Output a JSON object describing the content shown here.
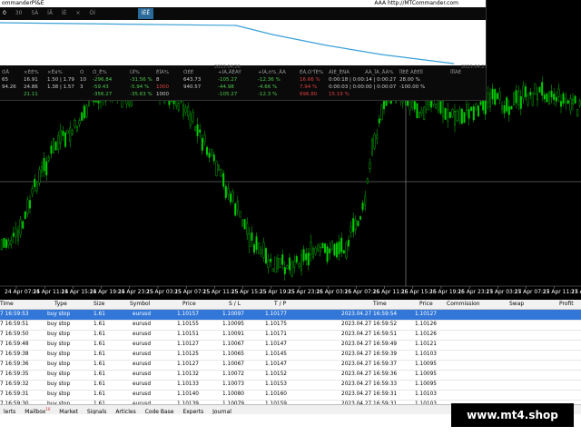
{
  "panel": {
    "title_left": "ommanderPl&E",
    "title_right": "ÀÂÀ http://MTCommander.com",
    "toolbar": [
      "0",
      "30",
      "5À",
      "ÍÃ",
      "ÌÈ",
      "×",
      "ÓÍ"
    ],
    "toolbar_badge": "ÍÈÊ",
    "equity_dates": [
      "2023.04.26",
      "2023.04.27"
    ],
    "stats_header": [
      "ÓÅ",
      "×ÈÉ%",
      "×Ëä%",
      "Ó",
      "Ó_Ë%",
      "ÙÎ%",
      "ÈÎÁ%",
      "ÓÉÉ",
      "+ÍÁ,ÄÊÀÝ",
      "+ÍÁ,ñ%¸ÄÀ",
      "ÉÁ,Ó\"ÏÈ%",
      "ÃÍÉ_ËÑÀ",
      "ÁÀ_ÏÀ¸ÄÀ%",
      "ÎÍÈÊ ÀÈÉÎÍ",
      "ÎÍÏÀÈ"
    ],
    "stats_rows": [
      [
        "65",
        "16.91",
        "1.50 | 1.79",
        "10",
        "-296.84",
        "-31.56 %",
        "8",
        "643.73",
        "-105.27",
        "-12.36 %",
        "16.66 %",
        "0:00:18 | 0:00:14 | 0:00:27",
        "28.00 %"
      ],
      [
        "94.26",
        "24.86",
        "1.38 | 1.57",
        "3",
        "-59.43",
        "-5.94 %",
        "1000",
        "940.57",
        "-44.98",
        "-4.66 %",
        "7.94 %",
        "0:00:03 | 0:00:00 | 0:00:07",
        "-100.00 %"
      ],
      [
        "",
        "21.11",
        "",
        "",
        "-356.27",
        "-35.63 %",
        "1000",
        "",
        "-105.27",
        "-12.3 %",
        "696.80",
        "15.19 %",
        ""
      ]
    ]
  },
  "chart_data": {
    "type": "candlestick",
    "x_tick_labels": [
      "24 Apr 07:15",
      "24 Apr 11:15",
      "24 Apr 15:15",
      "24 Apr 19:15",
      "24 Apr 23:15",
      "25 Apr 03:15",
      "25 Apr 07:15",
      "25 Apr 11:15",
      "25 Apr 15:15",
      "25 Apr 19:15",
      "25 Apr 23:15",
      "26 Apr 03:15",
      "26 Apr 07:15",
      "26 Apr 11:15",
      "26 Apr 15:15",
      "26 Apr 19:15",
      "26 Apr 23:15",
      "27 Apr 03:15",
      "27 Apr 07:15",
      "27 Apr 11:15",
      "27 Apr 15:15"
    ],
    "bull_color": "#00cc00",
    "bear_color": "#00cc00",
    "background": "#000000",
    "equity_color": "#3aa0d8"
  },
  "table": {
    "columns": [
      "Time",
      "Type",
      "Size",
      "Symbol",
      "Price",
      "S / L",
      "T / P",
      "Time",
      "Price",
      "Commission",
      "Swap",
      "Profit"
    ],
    "rows": [
      [
        "7 16:59:53",
        "buy stop",
        "1.61",
        "eurusd",
        "1.10157",
        "1.10097",
        "1.10177",
        "2023.04.27 16:59:54",
        "1.10127"
      ],
      [
        "7 16:59:51",
        "buy stop",
        "1.61",
        "eurusd",
        "1.10155",
        "1.10095",
        "1.10175",
        "2023.04.27 16:59:52",
        "1.10126"
      ],
      [
        "7 16:59:50",
        "buy stop",
        "1.61",
        "eurusd",
        "1.10151",
        "1.10091",
        "1.10171",
        "2023.04.27 16:59:51",
        "1.10126"
      ],
      [
        "7 16:59:48",
        "buy stop",
        "1.61",
        "eurusd",
        "1.10127",
        "1.10067",
        "1.10147",
        "2023.04.27 16:59:49",
        "1.10121"
      ],
      [
        "7 16:59:38",
        "buy stop",
        "1.61",
        "eurusd",
        "1.10125",
        "1.10065",
        "1.10145",
        "2023.04.27 16:59:39",
        "1.10103"
      ],
      [
        "7 16:59:36",
        "buy stop",
        "1.61",
        "eurusd",
        "1.10127",
        "1.10067",
        "1.10147",
        "2023.04.27 16:59:37",
        "1.10095"
      ],
      [
        "7 16:59:35",
        "buy stop",
        "1.61",
        "eurusd",
        "1.10132",
        "1.10072",
        "1.10152",
        "2023.04.27 16:59:36",
        "1.10095"
      ],
      [
        "7 16:59:32",
        "buy stop",
        "1.61",
        "eurusd",
        "1.10133",
        "1.10073",
        "1.10153",
        "2023.04.27 16:59:33",
        "1.10095"
      ],
      [
        "7 16:59:31",
        "buy stop",
        "1.61",
        "eurusd",
        "1.10140",
        "1.10080",
        "1.10160",
        "2023.04.27 16:59:31",
        "1.10103"
      ],
      [
        "7 16:59:30",
        "buy stop",
        "1.61",
        "eurusd",
        "1.10139",
        "1.10079",
        "1.10159",
        "2023.04.27 16:59:31",
        "1.10103"
      ]
    ]
  },
  "tabs": [
    "lerts",
    "Mailbox",
    "Market",
    "Signals",
    "Articles",
    "Code Base",
    "Experts",
    "Journal"
  ],
  "mailbox_badge": "10",
  "watermark": "www.mt4.shop"
}
